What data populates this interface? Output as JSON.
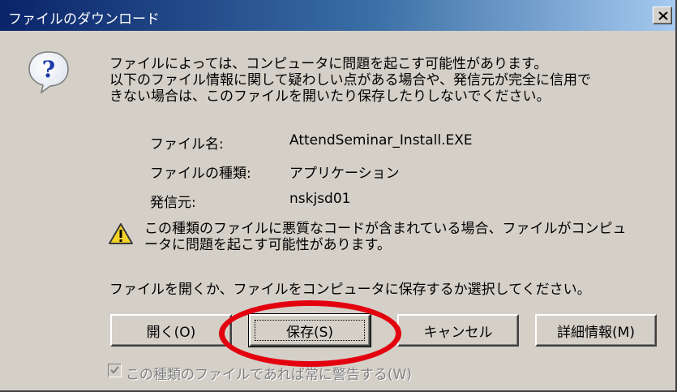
{
  "window": {
    "title": "ファイルのダウンロード",
    "close_label": "×"
  },
  "message": {
    "line1": "ファイルによっては、コンピュータに問題を起こす可能性があります。",
    "line2": "以下のファイル情報に関して疑わしい点がある場合や、発信元が完全に信用で",
    "line3": "きない場合は、このファイルを開いたり保存したりしないでください。"
  },
  "file_info": {
    "name_label": "ファイル名:",
    "name_value": "AttendSeminar_Install.EXE",
    "type_label": "ファイルの種類:",
    "type_value": "アプリケーション",
    "publisher_label": "発信元:",
    "publisher_value": "nskjsd01"
  },
  "warning": {
    "line1": "この種類のファイルに悪質なコードが含まれている場合、ファイルがコンピュ",
    "line2": "ータに問題を起こす可能性があります。"
  },
  "prompt": "ファイルを開くか、ファイルをコンピュータに保存するか選択してください。",
  "buttons": {
    "open": "開く(O)",
    "save": "保存(S)",
    "cancel": "キャンセル",
    "details": "詳細情報(M)"
  },
  "checkbox": {
    "label": "この種類のファイルであれば常に警告する(W)",
    "checked": true,
    "disabled": true
  },
  "colors": {
    "titlebar_start": "#0a246a",
    "titlebar_end": "#a6caf0",
    "dialog_face": "#d4d0c8",
    "annotation_ring": "#e3000f"
  },
  "icons": {
    "dialog": "question-icon",
    "warning": "warning-icon",
    "close": "close-icon"
  }
}
